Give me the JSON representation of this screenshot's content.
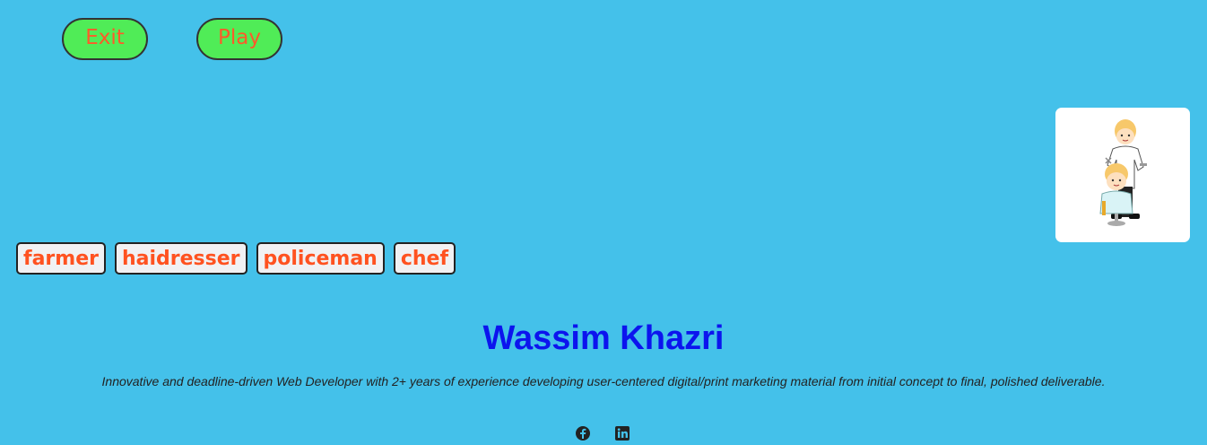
{
  "controls": {
    "exit_label": "Exit",
    "play_label": "Play"
  },
  "picture": {
    "icon": "hairdresser-cartoon"
  },
  "choices": [
    {
      "label": "farmer"
    },
    {
      "label": "haidresser"
    },
    {
      "label": "policeman"
    },
    {
      "label": "chef"
    }
  ],
  "footer": {
    "name": "Wassim Khazri",
    "bio": "Innovative and deadline-driven Web Developer with 2+ years of experience developing user-centered digital/print marketing material from initial concept to final, polished deliverable.",
    "social_icons": [
      "facebook-icon",
      "linkedin-icon"
    ]
  },
  "colors": {
    "background": "#44c1ea",
    "button_green": "#50ec57",
    "button_text": "#ff5a2a",
    "name_blue": "#0c14ee"
  }
}
